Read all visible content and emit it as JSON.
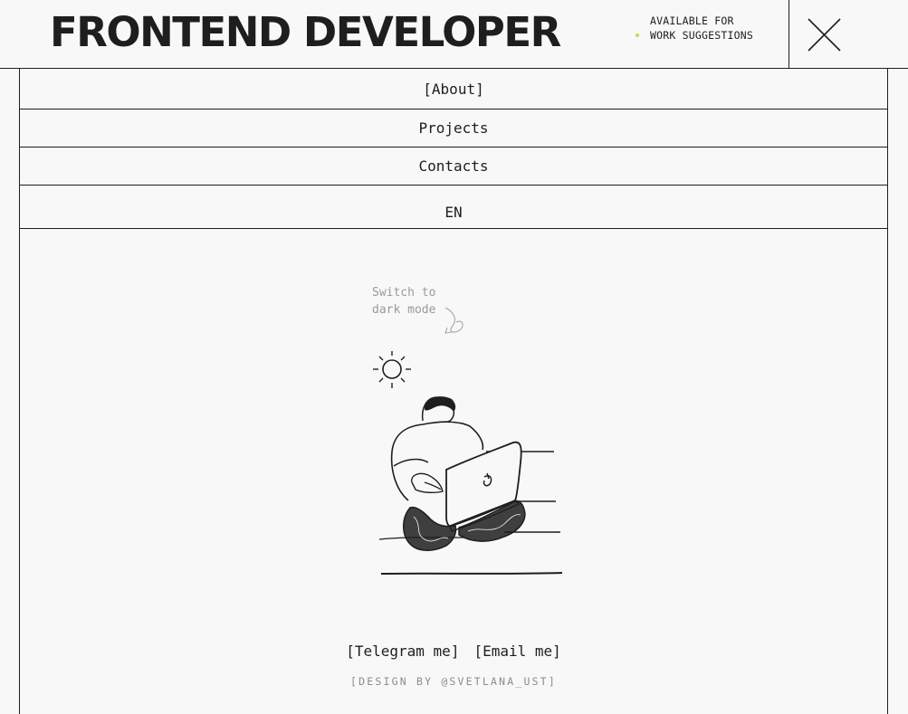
{
  "header": {
    "title": "FRONTEND DEVELOPER",
    "status_text": "AVAILABLE FOR WORK SUGGESTIONS",
    "status_dot_color": "#b8e23a",
    "close_icon": "close-icon"
  },
  "menu": {
    "items": [
      {
        "label": "[About]"
      },
      {
        "label": "Projects"
      },
      {
        "label": "Contacts"
      }
    ],
    "language": "EN"
  },
  "theme": {
    "hint": "Switch to dark mode",
    "icon": "sun-icon"
  },
  "footer": {
    "telegram": "[Telegram me]",
    "email": "[Email me]",
    "credit": "[DESIGN BY @SVETLANA_UST]"
  },
  "colors": {
    "background": "#f8f8f8",
    "ink": "#1e1e1e",
    "muted": "#9a9a9a",
    "accent": "#b8e23a"
  }
}
